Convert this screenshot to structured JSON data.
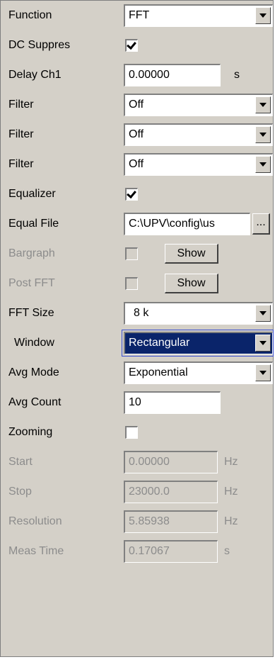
{
  "rows": {
    "function": {
      "label": "Function",
      "value": "FFT"
    },
    "dc_suppress": {
      "label": "DC Suppres",
      "checked": true
    },
    "delay_ch1": {
      "label": "Delay Ch1",
      "value": "0.00000",
      "unit": "s"
    },
    "filter1": {
      "label": "Filter",
      "value": "Off"
    },
    "filter2": {
      "label": "Filter",
      "value": "Off"
    },
    "filter3": {
      "label": "Filter",
      "value": "Off"
    },
    "equalizer": {
      "label": "Equalizer",
      "checked": true
    },
    "equal_file": {
      "label": "Equal File",
      "value": "C:\\UPV\\config\\us",
      "browse": "..."
    },
    "bargraph": {
      "label": "Bargraph",
      "checked": false,
      "button": "Show"
    },
    "post_fft": {
      "label": "Post FFT",
      "checked": false,
      "button": "Show"
    },
    "fft_size": {
      "label": "FFT Size",
      "value": "8 k"
    },
    "window": {
      "label": "Window",
      "value": "Rectangular"
    },
    "avg_mode": {
      "label": "Avg Mode",
      "value": "Exponential"
    },
    "avg_count": {
      "label": "Avg Count",
      "value": "10"
    },
    "zooming": {
      "label": "Zooming",
      "checked": false
    },
    "start": {
      "label": "Start",
      "value": "0.00000",
      "unit": "Hz"
    },
    "stop": {
      "label": "Stop",
      "value": "23000.0",
      "unit": "Hz"
    },
    "resolution": {
      "label": "Resolution",
      "value": "5.85938",
      "unit": "Hz"
    },
    "meas_time": {
      "label": "Meas Time",
      "value": "0.17067",
      "unit": "s"
    }
  },
  "icons": {
    "dropdown": "chevron-down-icon",
    "check": "checkmark-icon"
  },
  "colors": {
    "panel": "#d4d0c8",
    "selection": "#0a246a",
    "focus_border": "#3b4fcf",
    "disabled_text": "#8c8c8c"
  }
}
